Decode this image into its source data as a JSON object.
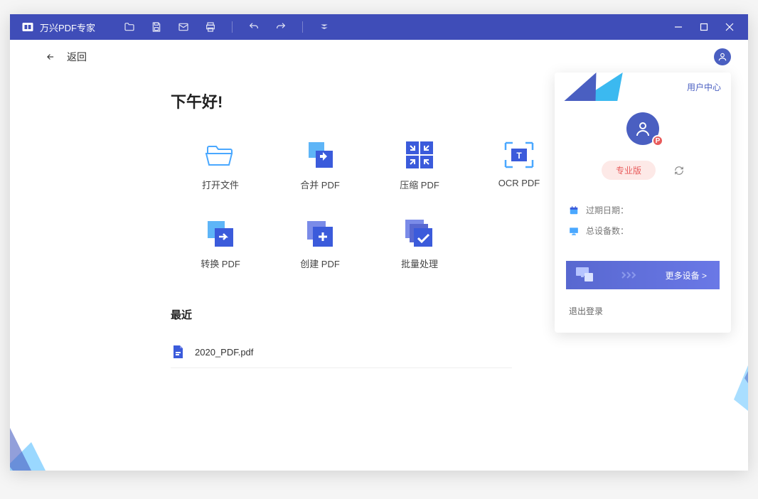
{
  "app": {
    "title": "万兴PDF专家"
  },
  "back": {
    "label": "返回"
  },
  "greeting": "下午好!",
  "actions": [
    {
      "id": "open-file",
      "label": "打开文件"
    },
    {
      "id": "merge-pdf",
      "label": "合并 PDF"
    },
    {
      "id": "compress-pdf",
      "label": "压缩 PDF"
    },
    {
      "id": "ocr-pdf",
      "label": "OCR PDF"
    },
    {
      "id": "convert-pdf",
      "label": "转换 PDF"
    },
    {
      "id": "create-pdf",
      "label": "创建 PDF"
    },
    {
      "id": "batch",
      "label": "批量处理"
    }
  ],
  "recent": {
    "title": "最近",
    "files": [
      {
        "name": "2020_PDF.pdf"
      }
    ]
  },
  "userPanel": {
    "userCenter": "用户中心",
    "proBadge": "专业版",
    "avatarBadge": "P",
    "expiryLabel": "过期日期：",
    "devicesLabel": "总设备数：",
    "moreDevices": "更多设备 >",
    "logout": "退出登录"
  }
}
